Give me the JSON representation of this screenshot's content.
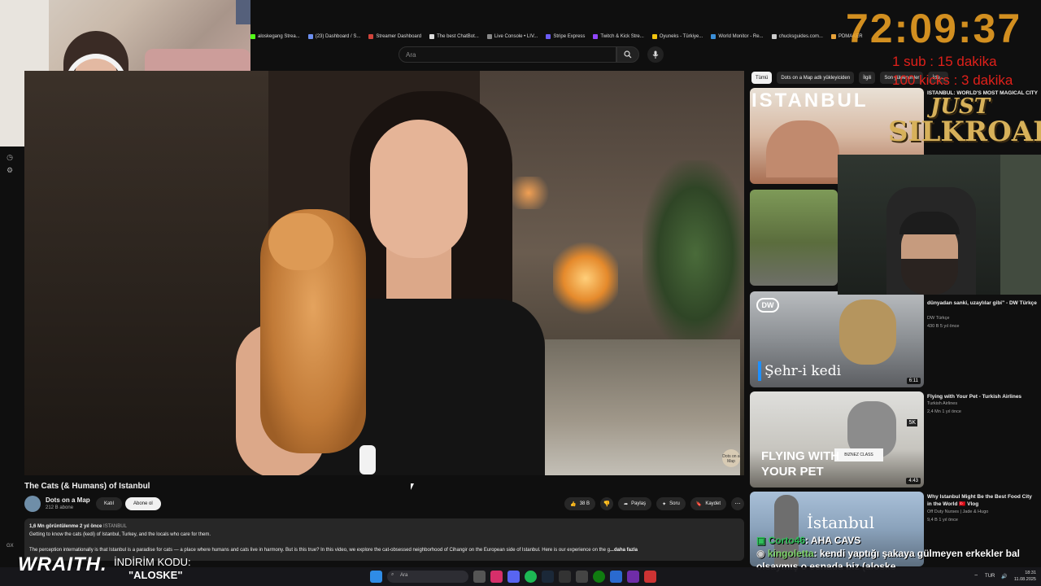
{
  "bookmarks": [
    {
      "label": "aloskegang Strea...",
      "color": "#53fc18"
    },
    {
      "label": "(23) Dashboard / S...",
      "color": "#6c8ff0"
    },
    {
      "label": "Streamer Dashboard",
      "color": "#d1443b"
    },
    {
      "label": "The best ChatBot...",
      "color": "#dddddd"
    },
    {
      "label": "Live Console • LIV...",
      "color": "#888888"
    },
    {
      "label": "Stripe Express",
      "color": "#6b5cf6"
    },
    {
      "label": "Twitch & Kick Stre...",
      "color": "#9146ff"
    },
    {
      "label": "Oyuneks - Türkiye...",
      "color": "#f1c40f"
    },
    {
      "label": "World Monitor - Re...",
      "color": "#3a8fd8"
    },
    {
      "label": "chucksguides.com...",
      "color": "#cccccc"
    },
    {
      "label": "PDMAKER",
      "color": "#e8a33a"
    }
  ],
  "search": {
    "placeholder": "Ara"
  },
  "video": {
    "title": "The Cats (& Humans) of Istanbul",
    "channel": "Dots on a Map",
    "subscribers": "212 B abone",
    "watermark": "Dots on a Map",
    "join_label": "Katıl",
    "subscribe_label": "Abone ol",
    "likes": "38 B",
    "share_label": "Paylaş",
    "ask_label": "Soru",
    "save_label": "Kaydet",
    "views_meta": "1,6 Mn görüntülenme  2 yıl önce",
    "hashtag": "ISTANBUL",
    "desc_line1": "Getting to know the cats (kedi) of Istanbul, Turkey, and the locals who care for them.",
    "desc_line2": "The perception internationally is that Istanbul is a paradise for cats — a place where humans and cats live in harmony. But is this true? In this video, we explore the cat-obsessed neighborhood of Cihangir on the European side of Istanbul. Here is our experience on the g",
    "more": "...daha fazla"
  },
  "chips": [
    "Tümü",
    "Dots on a Map adlı yükleyiciden",
    "İlgili",
    "Son yüklenenler",
    "İzle..."
  ],
  "recommendations": [
    {
      "title": "ISTANBUL: WORLD'S MOST MAGICAL CITY",
      "channel": "",
      "meta": "",
      "duration": "",
      "thumb_text": "ISTANBUL"
    },
    {
      "title": "",
      "channel": "",
      "meta": "",
      "duration": "",
      "thumb_text": ""
    },
    {
      "title": "dünyadan sanki, uzaylılar gibi\" - DW Türkçe",
      "channel": "DW Türkçe",
      "meta": "430 B  5 yıl önce",
      "duration": "6:11",
      "thumb_text": "Şehr-i kedi",
      "thumb_logo": "DW"
    },
    {
      "title": "Flying with Your Pet - Turkish Airlines",
      "channel": "Turkish Airlines",
      "meta": "2,4 Mn  1 yıl önce",
      "duration": "4:43",
      "thumb_text": "FLYING WITH YOUR PET",
      "thumb_badge": "BIZNEZ CLASS",
      "thumb_corner": "5K"
    },
    {
      "title": "Why Istanbul Might Be the Best Food City in the World 🇹🇷 Vlog",
      "channel": "Off Duty Nurses | Jade & Hugo",
      "meta": "9,4 B  1 yıl önce",
      "duration": "",
      "thumb_text": "İstanbul"
    }
  ],
  "overlay": {
    "timer": "72:09:37",
    "sub_rule": "1 sub : 15 dakika",
    "kick_rule": "100 kicks : 3 dakika",
    "logo_line1": "JUST",
    "logo_line2": "SILKROAD"
  },
  "chat": [
    {
      "user": "Corto46",
      "message": ": AHA CAVS"
    },
    {
      "user": "kingoletta",
      "message": ": kendi yaptığı şakaya gülmeyen erkekler bal olsaymış o esnada biz (aloske"
    }
  ],
  "sponsor": {
    "brand": "WRAITH.",
    "promo_label": "İNDİRİM KODU:",
    "promo_code": "\"ALOSKE\""
  },
  "taskbar": {
    "search_placeholder": "Ara",
    "language": "TUR",
    "time": "18:31",
    "date": "11.08.2025"
  },
  "gx_label": "GX",
  "colors": {
    "accent": "#f5a623",
    "rule": "#e0201a",
    "chat_user": "#2fbf5a"
  }
}
